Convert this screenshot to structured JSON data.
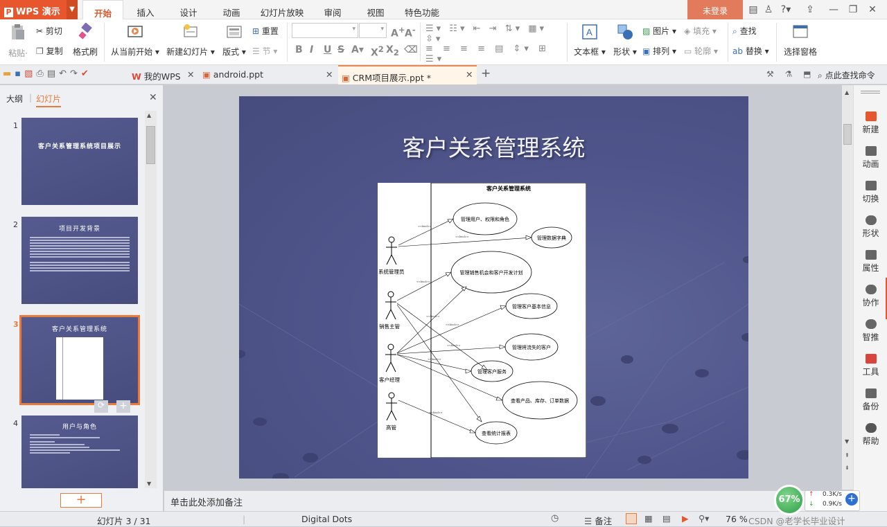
{
  "app": {
    "name": "WPS 演示",
    "login": "未登录"
  },
  "menu_tabs": [
    "开始",
    "插入",
    "设计",
    "动画",
    "幻灯片放映",
    "审阅",
    "视图",
    "特色功能"
  ],
  "ribbon": {
    "paste": "粘贴",
    "cut": "剪切",
    "copy": "复制",
    "format_painter": "格式刷",
    "from_current": "从当前开始",
    "new_slide": "新建幻灯片",
    "layout": "版式",
    "reset": "重置",
    "section": "节",
    "textbox": "文本框",
    "shape": "形状",
    "picture": "图片",
    "fill": "填充",
    "arrange": "排列",
    "outline": "轮廓",
    "find": "查找",
    "replace": "替换",
    "select_pane": "选择窗格"
  },
  "doc_tabs": [
    {
      "label": "我的WPS"
    },
    {
      "label": "android.ppt"
    },
    {
      "label": "CRM项目展示.ppt *",
      "active": true
    }
  ],
  "search_cmd": "点此查找命令",
  "left_panel": {
    "tab_outline": "大纲",
    "tab_slides": "幻灯片",
    "thumbs": [
      {
        "num": "1",
        "title": "客户关系管理系统项目展示"
      },
      {
        "num": "2",
        "title": "项目开发背景"
      },
      {
        "num": "3",
        "title": "客户关系管理系统",
        "selected": true
      },
      {
        "num": "4",
        "title": "用户与角色"
      }
    ]
  },
  "slide": {
    "title": "客户关系管理系统",
    "diagram": {
      "title": "客户关系管理系统",
      "actors": [
        "系统管理员",
        "销售主管",
        "客户经理",
        "高管"
      ],
      "use_cases": [
        "管理用户、权限和角色",
        "管理数据字典",
        "管理销售机会和客户开发计划",
        "管理客户基本信息",
        "管理将流失的客户",
        "管理客户服务",
        "查看产品、库存、订单数据",
        "查看统计报表"
      ],
      "stereo": "<<bind>>"
    }
  },
  "right_bar": [
    "新建",
    "动画",
    "切换",
    "形状",
    "属性",
    "协作",
    "智推",
    "工具",
    "备份",
    "帮助"
  ],
  "notes_placeholder": "单击此处添加备注",
  "status": {
    "slide_info": "幻灯片 3 / 31",
    "theme": "Digital Dots",
    "notes_btn": "备注",
    "zoom": "76 %",
    "watermark": "CSDN @老学长毕业设计"
  },
  "net_widget": {
    "percent": "67%",
    "up": "0.3K/s",
    "down": "0.9K/s"
  },
  "colors": {
    "brand": "#e8562d",
    "accent": "#e97a3a",
    "slide_bg": "#50568a"
  }
}
